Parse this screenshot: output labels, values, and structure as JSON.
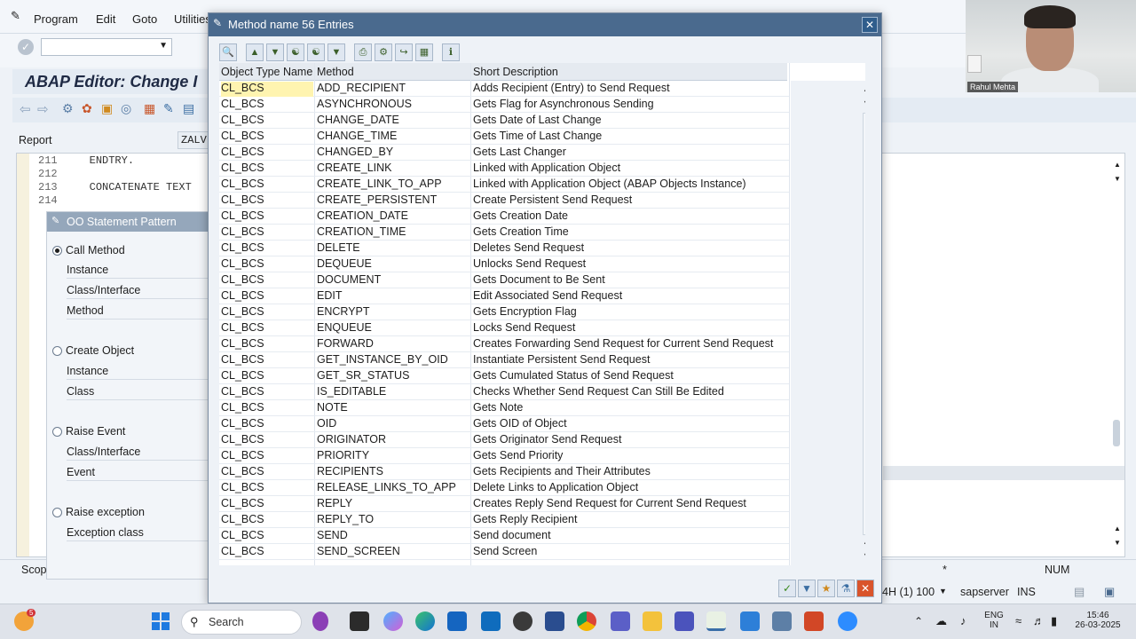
{
  "menu": [
    "Program",
    "Edit",
    "Goto",
    "Utilities"
  ],
  "editor": {
    "title": "ABAP Editor: Change I",
    "report_label": "Report",
    "report_value": "ZALV",
    "code_lines": [
      {
        "no": "211",
        "text": "    ENDTRY."
      },
      {
        "no": "212",
        "text": ""
      },
      {
        "no": "213",
        "text": "    CONCATENATE TEXT"
      },
      {
        "no": "214",
        "text": ""
      }
    ],
    "status_scope": "Scop",
    "status_star": "*",
    "status_num": "NUM",
    "system": "4H (1) 100",
    "server": "sapserver",
    "mode": "INS"
  },
  "oo_panel": {
    "title": "OO Statement Pattern",
    "groups": [
      {
        "label": "Call Method",
        "selected": true,
        "fields": [
          "Instance",
          "Class/Interface",
          "Method"
        ]
      },
      {
        "label": "Create Object",
        "selected": false,
        "fields": [
          "Instance",
          "Class"
        ]
      },
      {
        "label": "Raise Event",
        "selected": false,
        "fields": [
          "Class/Interface",
          "Event"
        ]
      },
      {
        "label": "Raise exception",
        "selected": false,
        "fields": [
          "Exception class"
        ]
      }
    ]
  },
  "dialog": {
    "title": "Method name   56 Entries",
    "columns": [
      "Object Type Name",
      "Method",
      "Short Description"
    ],
    "rows": [
      [
        "CL_BCS",
        "ADD_RECIPIENT",
        "Adds Recipient (Entry) to Send Request"
      ],
      [
        "CL_BCS",
        "ASYNCHRONOUS",
        "Gets Flag for Asynchronous Sending"
      ],
      [
        "CL_BCS",
        "CHANGE_DATE",
        "Gets Date of Last Change"
      ],
      [
        "CL_BCS",
        "CHANGE_TIME",
        "Gets Time of Last Change"
      ],
      [
        "CL_BCS",
        "CHANGED_BY",
        "Gets Last Changer"
      ],
      [
        "CL_BCS",
        "CREATE_LINK",
        "Linked with Application Object"
      ],
      [
        "CL_BCS",
        "CREATE_LINK_TO_APP",
        "Linked with Application Object (ABAP Objects Instance)"
      ],
      [
        "CL_BCS",
        "CREATE_PERSISTENT",
        "Create Persistent Send Request"
      ],
      [
        "CL_BCS",
        "CREATION_DATE",
        "Gets Creation Date"
      ],
      [
        "CL_BCS",
        "CREATION_TIME",
        "Gets Creation Time"
      ],
      [
        "CL_BCS",
        "DELETE",
        "Deletes Send Request"
      ],
      [
        "CL_BCS",
        "DEQUEUE",
        "Unlocks Send Request"
      ],
      [
        "CL_BCS",
        "DOCUMENT",
        "Gets Document to Be Sent"
      ],
      [
        "CL_BCS",
        "EDIT",
        "Edit Associated Send Request"
      ],
      [
        "CL_BCS",
        "ENCRYPT",
        "Gets Encryption Flag"
      ],
      [
        "CL_BCS",
        "ENQUEUE",
        "Locks Send Request"
      ],
      [
        "CL_BCS",
        "FORWARD",
        "Creates Forwarding Send Request for Current Send Request"
      ],
      [
        "CL_BCS",
        "GET_INSTANCE_BY_OID",
        "Instantiate Persistent Send Request"
      ],
      [
        "CL_BCS",
        "GET_SR_STATUS",
        "Gets Cumulated Status of Send Request"
      ],
      [
        "CL_BCS",
        "IS_EDITABLE",
        "Checks Whether Send Request Can Still Be Edited"
      ],
      [
        "CL_BCS",
        "NOTE",
        "Gets Note"
      ],
      [
        "CL_BCS",
        "OID",
        "Gets OID of Object"
      ],
      [
        "CL_BCS",
        "ORIGINATOR",
        "Gets Originator Send Request"
      ],
      [
        "CL_BCS",
        "PRIORITY",
        "Gets Send Priority"
      ],
      [
        "CL_BCS",
        "RECIPIENTS",
        "Gets Recipients and Their Attributes"
      ],
      [
        "CL_BCS",
        "RELEASE_LINKS_TO_APP",
        "Delete Links to Application Object"
      ],
      [
        "CL_BCS",
        "REPLY",
        "Creates Reply Send Request for Current Send Request"
      ],
      [
        "CL_BCS",
        "REPLY_TO",
        "Gets Reply Recipient"
      ],
      [
        "CL_BCS",
        "SEND",
        "Send document"
      ],
      [
        "CL_BCS",
        "SEND_SCREEN",
        "Send Screen"
      ]
    ],
    "selected_row": 0
  },
  "webcam": {
    "name": "Rahul Mehta"
  },
  "taskbar": {
    "search_placeholder": "Search",
    "lang_top": "ENG",
    "lang_bottom": "IN",
    "time": "15:46",
    "date": "26-03-2025",
    "notification_badge": "5"
  },
  "colors": {
    "dialog_title_bg": "#4a6a8e",
    "selected_cell": "#fff4b0",
    "close_button": "#2f5d8c"
  }
}
